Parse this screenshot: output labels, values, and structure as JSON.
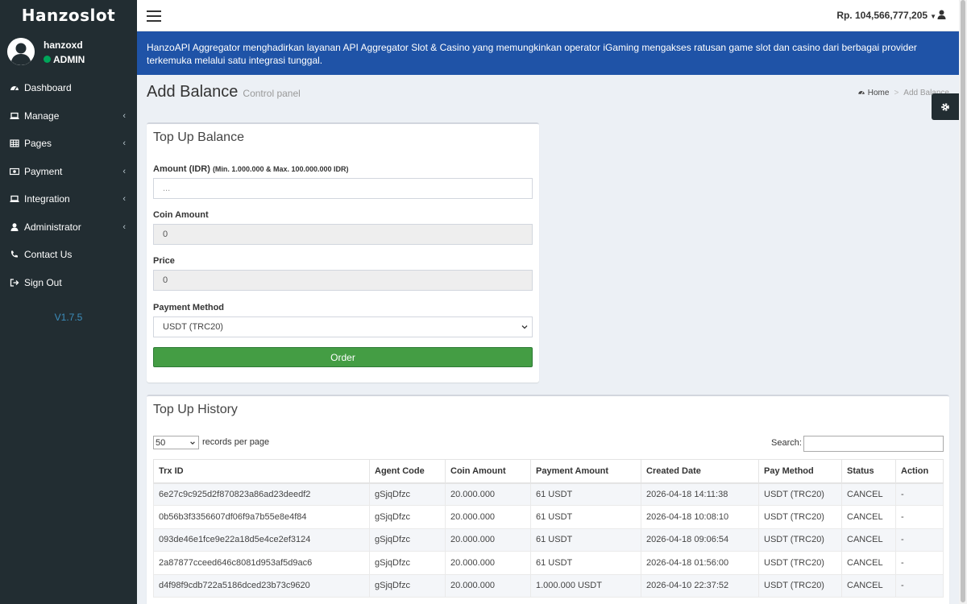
{
  "brand": "Hanzoslot",
  "user": {
    "name": "hanzoxd",
    "role": "ADMIN"
  },
  "sidebar": {
    "items": [
      {
        "label": "Dashboard",
        "icon": "dashboard-icon",
        "has_children": false
      },
      {
        "label": "Manage",
        "icon": "laptop-icon",
        "has_children": true
      },
      {
        "label": "Pages",
        "icon": "table-icon",
        "has_children": true
      },
      {
        "label": "Payment",
        "icon": "money-icon",
        "has_children": true
      },
      {
        "label": "Integration",
        "icon": "laptop-icon",
        "has_children": true
      },
      {
        "label": "Administrator",
        "icon": "user-icon",
        "has_children": true
      },
      {
        "label": "Contact Us",
        "icon": "phone-icon",
        "has_children": false
      },
      {
        "label": "Sign Out",
        "icon": "sign-out-icon",
        "has_children": false
      }
    ],
    "version": "V1.7.5"
  },
  "header": {
    "balance": "Rp. 104,566,777,205"
  },
  "notice": "HanzoAPI Aggregator menghadirkan layanan API Aggregator Slot & Casino yang memungkinkan operator iGaming mengakses ratusan game slot dan casino dari berbagai provider terkemuka melalui satu integrasi tunggal.",
  "page": {
    "title": "Add Balance",
    "subtitle": "Control panel",
    "breadcrumb": {
      "home": "Home",
      "current": "Add Balance"
    }
  },
  "topup": {
    "title": "Top Up Balance",
    "amount_label": "Amount (IDR)",
    "amount_hint": "(Min. 1.000.000 & Max. 100.000.000 IDR)",
    "amount_placeholder": "...",
    "coin_label": "Coin Amount",
    "coin_value": "0",
    "price_label": "Price",
    "price_value": "0",
    "payment_label": "Payment Method",
    "payment_value": "USDT (TRC20)",
    "order_label": "Order"
  },
  "history": {
    "title": "Top Up History",
    "records_per_page": "50",
    "records_label": "records per page",
    "search_label": "Search:",
    "columns": [
      "Trx ID",
      "Agent Code",
      "Coin Amount",
      "Payment Amount",
      "Created Date",
      "Pay Method",
      "Status",
      "Action"
    ],
    "rows": [
      [
        "6e27c9c925d2f870823a86ad23deedf2",
        "gSjqDfzc",
        "20.000.000",
        "61 USDT",
        "2026-04-18 14:11:38",
        "USDT (TRC20)",
        "CANCEL",
        "-"
      ],
      [
        "0b56b3f3356607df06f9a7b55e8e4f84",
        "gSjqDfzc",
        "20.000.000",
        "61 USDT",
        "2026-04-18 10:08:10",
        "USDT (TRC20)",
        "CANCEL",
        "-"
      ],
      [
        "093de46e1fce9e22a18d5e4ce2ef3124",
        "gSjqDfzc",
        "20.000.000",
        "61 USDT",
        "2026-04-18 09:06:54",
        "USDT (TRC20)",
        "CANCEL",
        "-"
      ],
      [
        "2a87877cceed646c8081d953af5d9ac6",
        "gSjqDfzc",
        "20.000.000",
        "61 USDT",
        "2026-04-18 01:56:00",
        "USDT (TRC20)",
        "CANCEL",
        "-"
      ],
      [
        "d4f98f9cdb722a5186dced23b73c9620",
        "gSjqDfzc",
        "20.000.000",
        "1.000.000 USDT",
        "2026-04-10 22:37:52",
        "USDT (TRC20)",
        "CANCEL",
        "-"
      ]
    ]
  }
}
